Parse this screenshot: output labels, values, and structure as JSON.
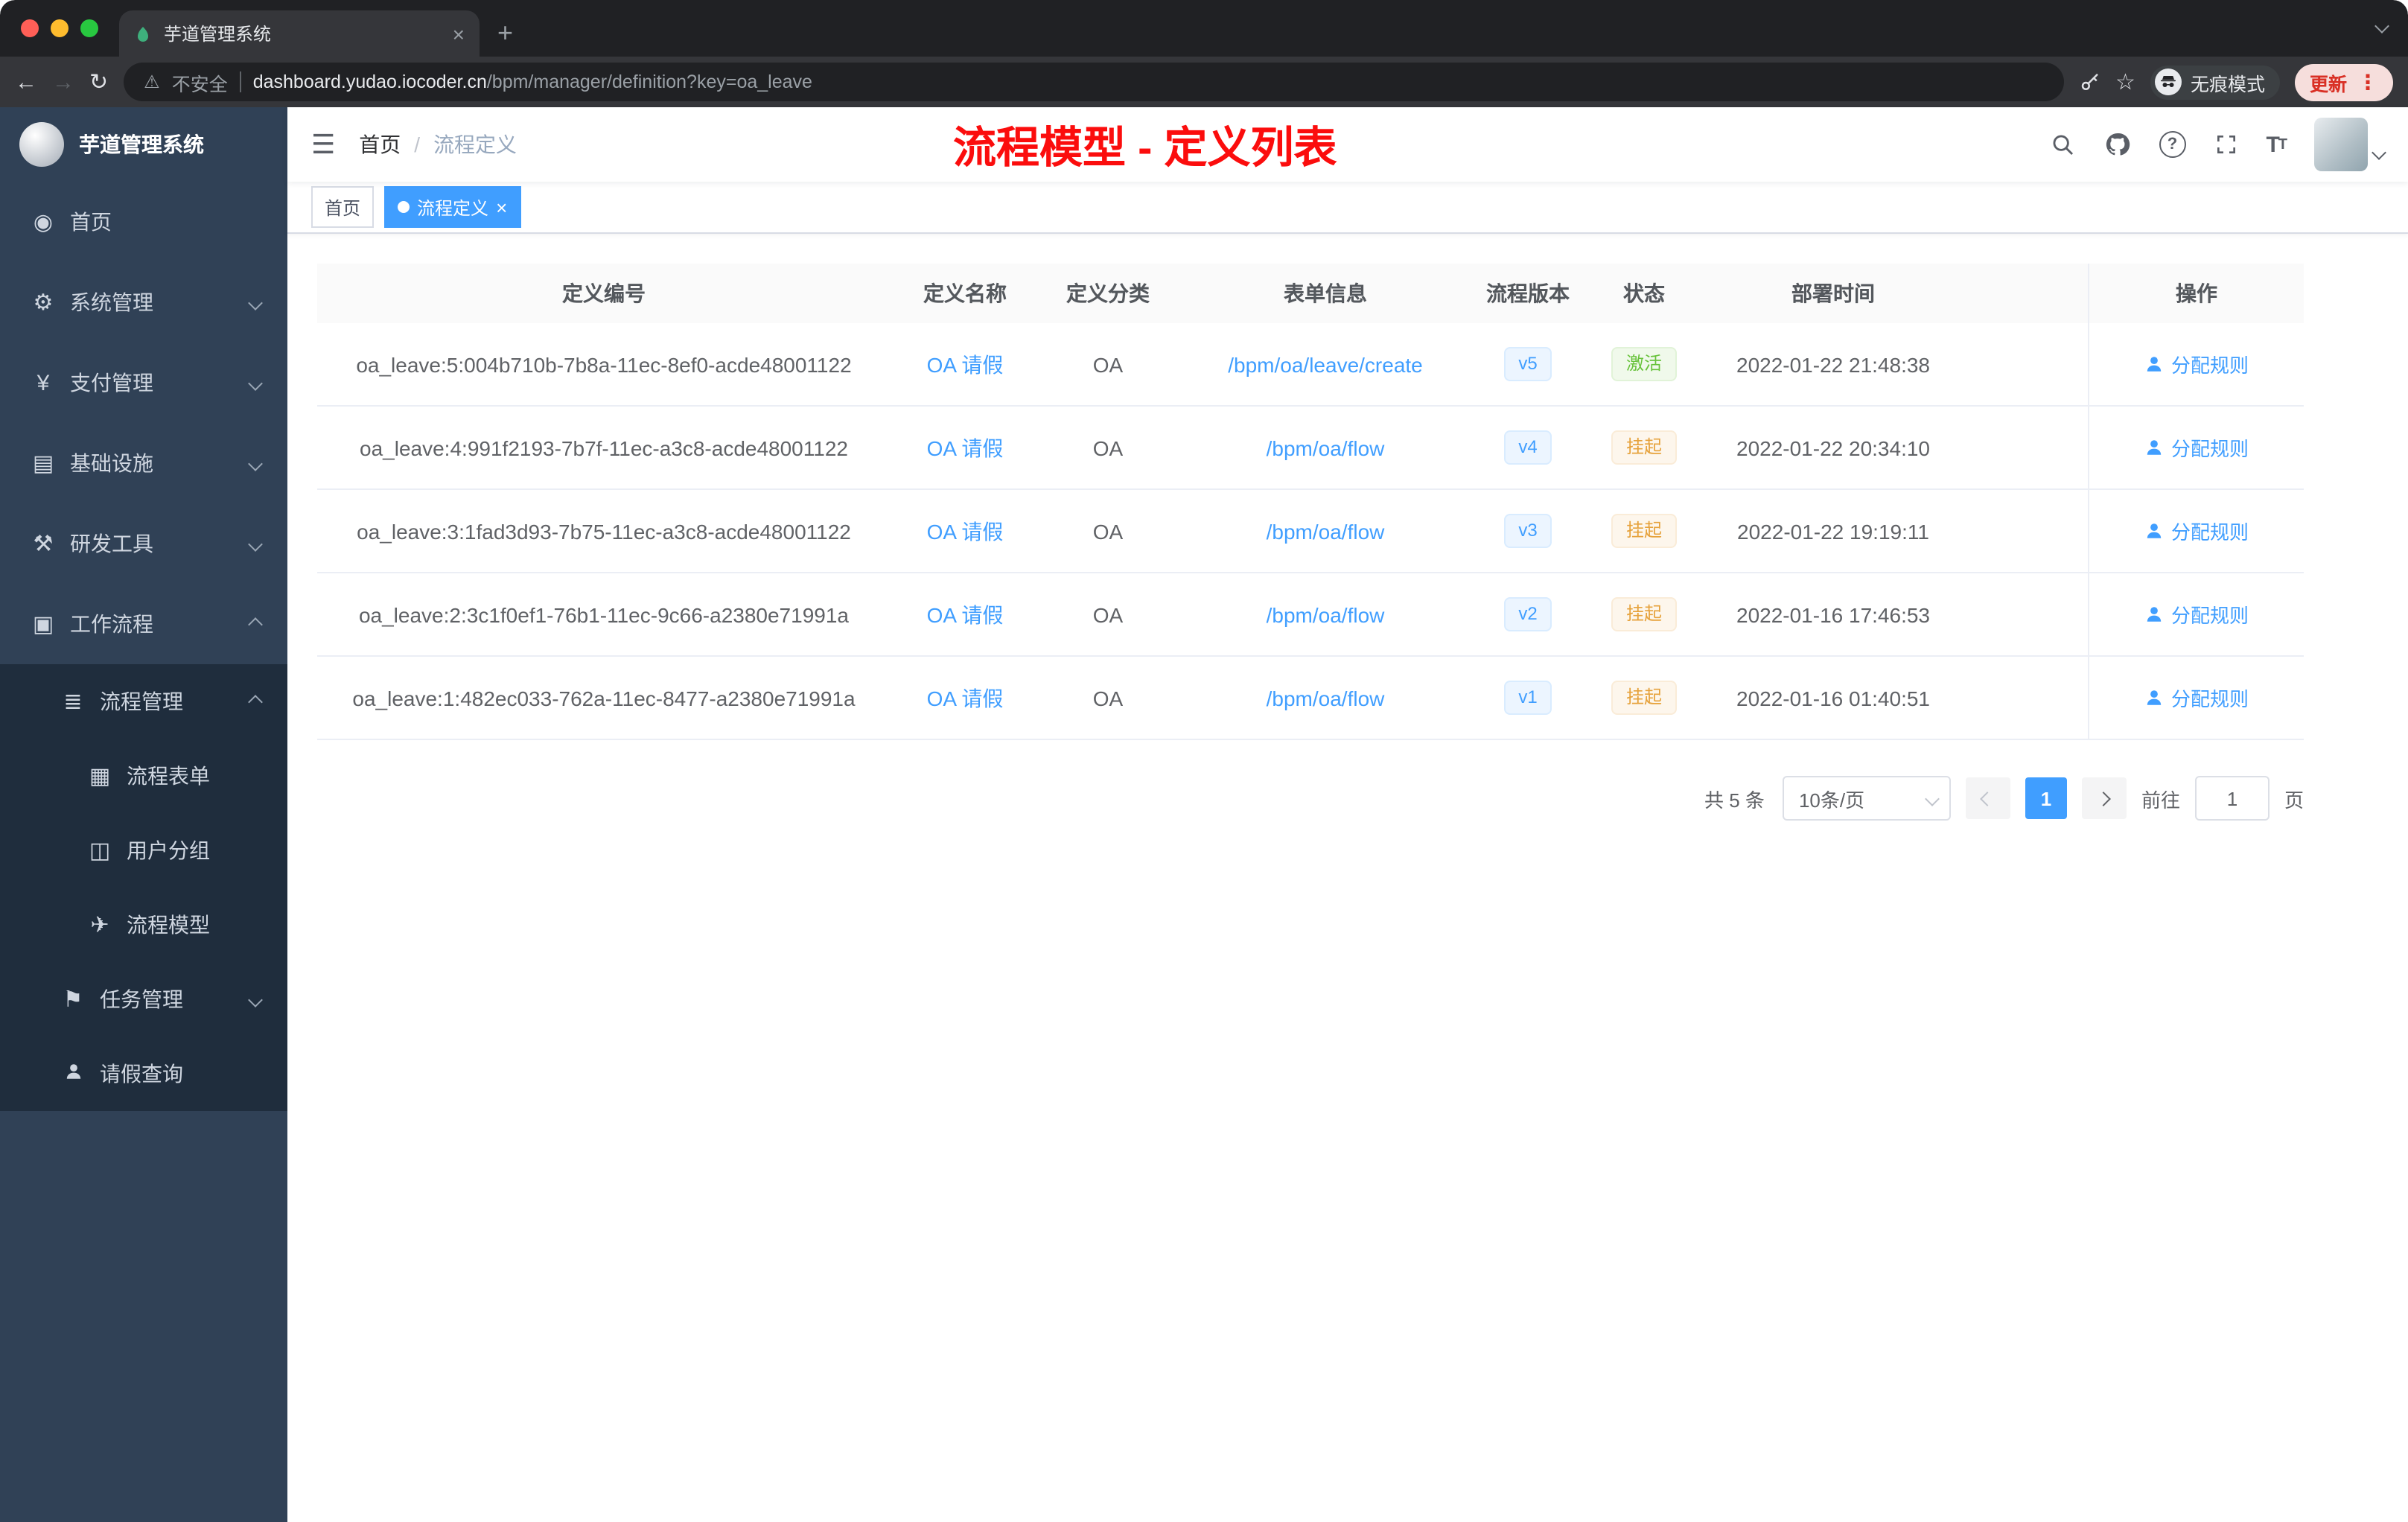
{
  "browser": {
    "tab_title": "芋道管理系统",
    "security_label": "不安全",
    "url_domain": "dashboard.yudao.iocoder.cn",
    "url_path": "/bpm/manager/definition?key=oa_leave",
    "incognito_label": "无痕模式",
    "update_label": "更新"
  },
  "app": {
    "logo_title": "芋道管理系统",
    "breadcrumb": {
      "home": "首页",
      "separator": "/",
      "current": "流程定义"
    },
    "overlay_title": "流程模型 - 定义列表",
    "tags": [
      {
        "label": "首页",
        "active": false
      },
      {
        "label": "流程定义",
        "active": true
      }
    ]
  },
  "icons": {
    "dashboard-icon": "◉",
    "gear-icon": "⚙",
    "payment-icon": "¥",
    "infrastructure-icon": "▤",
    "tools-icon": "⚒",
    "workflow-icon": "▣",
    "process-manage-icon": "≣",
    "form-icon": "▦",
    "user-group-icon": "◫",
    "model-icon": "✈",
    "task-icon": "⚑"
  },
  "sidebar": {
    "items": [
      {
        "key": "home",
        "label": "首页",
        "icon": "dashboard-icon",
        "level": 1
      },
      {
        "key": "system",
        "label": "系统管理",
        "icon": "gear-icon",
        "level": 1,
        "chevron": "down"
      },
      {
        "key": "payment",
        "label": "支付管理",
        "icon": "payment-icon",
        "level": 1,
        "chevron": "down"
      },
      {
        "key": "infrastructure",
        "label": "基础设施",
        "icon": "infrastructure-icon",
        "level": 1,
        "chevron": "down"
      },
      {
        "key": "devtools",
        "label": "研发工具",
        "icon": "tools-icon",
        "level": 1,
        "chevron": "down"
      },
      {
        "key": "workflow",
        "label": "工作流程",
        "icon": "workflow-icon",
        "level": 1,
        "chevron": "up"
      },
      {
        "key": "process-manage",
        "label": "流程管理",
        "icon": "process-manage-icon",
        "level": 2,
        "chevron": "up",
        "dark": true
      },
      {
        "key": "process-form",
        "label": "流程表单",
        "icon": "form-icon",
        "level": 3,
        "dark": true
      },
      {
        "key": "user-group",
        "label": "用户分组",
        "icon": "user-group-icon",
        "level": 3,
        "dark": true
      },
      {
        "key": "process-model",
        "label": "流程模型",
        "icon": "model-icon",
        "level": 3,
        "dark": true
      },
      {
        "key": "task-manage",
        "label": "任务管理",
        "icon": "task-icon",
        "level": 2,
        "chevron": "down",
        "dark": true
      },
      {
        "key": "leave-query",
        "label": "请假查询",
        "icon": "person-icon",
        "level": 2,
        "dark": true
      }
    ]
  },
  "table": {
    "columns": [
      "定义编号",
      "定义名称",
      "定义分类",
      "表单信息",
      "流程版本",
      "状态",
      "部署时间",
      "操作"
    ],
    "action_label": "分配规则",
    "rows": [
      {
        "id": "oa_leave:5:004b710b-7b8a-11ec-8ef0-acde48001122",
        "name": "OA 请假",
        "category": "OA",
        "form": "/bpm/oa/leave/create",
        "version": "v5",
        "status": "激活",
        "status_type": "success",
        "deploy_time": "2022-01-22 21:48:38"
      },
      {
        "id": "oa_leave:4:991f2193-7b7f-11ec-a3c8-acde48001122",
        "name": "OA 请假",
        "category": "OA",
        "form": "/bpm/oa/flow",
        "version": "v4",
        "status": "挂起",
        "status_type": "warning",
        "deploy_time": "2022-01-22 20:34:10"
      },
      {
        "id": "oa_leave:3:1fad3d93-7b75-11ec-a3c8-acde48001122",
        "name": "OA 请假",
        "category": "OA",
        "form": "/bpm/oa/flow",
        "version": "v3",
        "status": "挂起",
        "status_type": "warning",
        "deploy_time": "2022-01-22 19:19:11"
      },
      {
        "id": "oa_leave:2:3c1f0ef1-76b1-11ec-9c66-a2380e71991a",
        "name": "OA 请假",
        "category": "OA",
        "form": "/bpm/oa/flow",
        "version": "v2",
        "status": "挂起",
        "status_type": "warning",
        "deploy_time": "2022-01-16 17:46:53"
      },
      {
        "id": "oa_leave:1:482ec033-762a-11ec-8477-a2380e71991a",
        "name": "OA 请假",
        "category": "OA",
        "form": "/bpm/oa/flow",
        "version": "v1",
        "status": "挂起",
        "status_type": "warning",
        "deploy_time": "2022-01-16 01:40:51"
      }
    ]
  },
  "pagination": {
    "total": "共 5 条",
    "page_size": "10条/页",
    "current_page": "1",
    "goto_prefix": "前往",
    "goto_value": "1",
    "goto_suffix": "页"
  },
  "colors": {
    "primary": "#409eff",
    "success": "#67c23a",
    "warning": "#e6a23c",
    "overlay_red": "#fb0d0d",
    "sidebar_bg": "#304156",
    "sidebar_submenu_bg": "#1f2d3d"
  }
}
